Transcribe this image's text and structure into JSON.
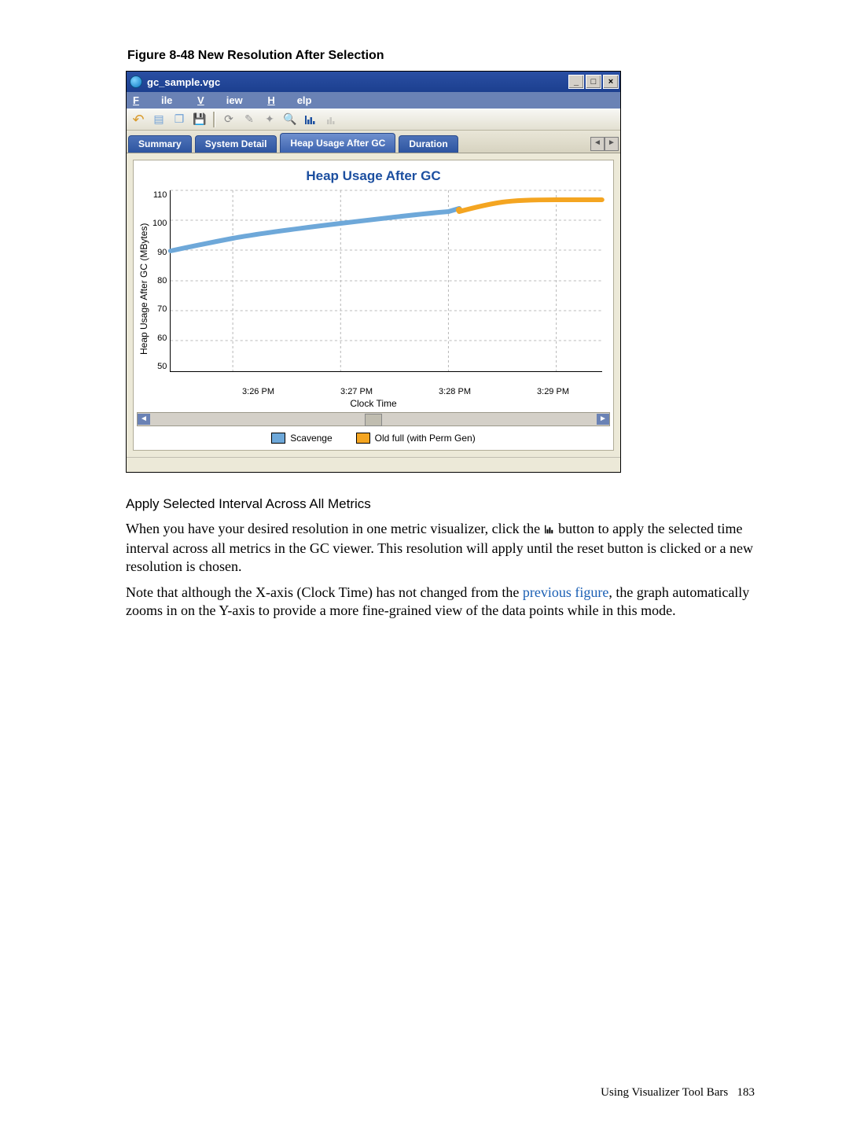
{
  "figure": {
    "caption": "Figure 8-48 New Resolution After Selection"
  },
  "window": {
    "title": "gc_sample.vgc",
    "controls": {
      "minimize": "_",
      "maximize": "□",
      "close": "×"
    }
  },
  "menubar": {
    "items": [
      "File",
      "View",
      "Help"
    ]
  },
  "tabs": {
    "items": [
      "Summary",
      "System Detail",
      "Heap Usage After GC",
      "Duration"
    ],
    "active_index": 2,
    "scroll_left": "◄",
    "scroll_right": "►"
  },
  "chart": {
    "title": "Heap Usage After GC",
    "xlabel": "Clock Time",
    "ylabel": "Heap Usage After GC  (MBytes)",
    "xticks": [
      "3:26 PM",
      "3:27 PM",
      "3:28 PM",
      "3:29 PM"
    ],
    "yticks": [
      "110",
      "100",
      "90",
      "80",
      "70",
      "60",
      "50"
    ],
    "legend": [
      {
        "name": "Scavenge",
        "color": "#6ea8d9"
      },
      {
        "name": "Old full (with Perm Gen)",
        "color": "#f4a521"
      }
    ]
  },
  "chart_data": {
    "type": "line",
    "xlabel": "Clock Time",
    "ylabel": "Heap Usage After GC (MBytes)",
    "ylim": [
      50,
      115
    ],
    "x": [
      "3:26 PM",
      "3:27 PM",
      "3:28 PM",
      "3:29 PM"
    ],
    "series": [
      {
        "name": "Scavenge",
        "color": "#6ea8d9",
        "points": [
          {
            "x": "3:25:30 PM",
            "y": 90
          },
          {
            "x": "3:26 PM",
            "y": 94
          },
          {
            "x": "3:27 PM",
            "y": 99
          },
          {
            "x": "3:28 PM",
            "y": 103
          },
          {
            "x": "3:28:05 PM",
            "y": 104
          }
        ]
      },
      {
        "name": "Old full (with Perm Gen)",
        "color": "#f4a521",
        "points": [
          {
            "x": "3:28:05 PM",
            "y": 103
          },
          {
            "x": "3:28:30 PM",
            "y": 106
          },
          {
            "x": "3:29 PM",
            "y": 107
          },
          {
            "x": "3:29:30 PM",
            "y": 107
          }
        ]
      }
    ]
  },
  "body": {
    "subheading": "Apply Selected Interval Across All Metrics",
    "p1a": "When you have your desired resolution in one metric visualizer, click the ",
    "p1b": " button to apply the selected time interval across all metrics in the GC viewer. This resolution will apply until the reset button is clicked or a new resolution is chosen.",
    "p2a": "Note that although the X-axis (Clock Time) has not changed from the ",
    "p2_link": "previous figure",
    "p2b": ", the graph automatically zooms in on the Y-axis to provide a more fine-grained view of the data points while in this mode."
  },
  "footer": {
    "section": "Using Visualizer Tool Bars",
    "page": "183"
  }
}
